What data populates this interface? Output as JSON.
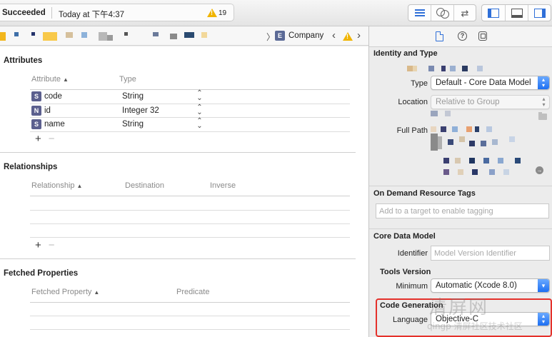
{
  "toolbar": {
    "status_text": "Succeeded",
    "status_time": "Today at 下午4:37",
    "warning_count": "19"
  },
  "jumpbar": {
    "entity_badge": "E",
    "entity_name": "Company"
  },
  "attributes": {
    "title": "Attributes",
    "col_attribute": "Attribute",
    "col_type": "Type",
    "rows": [
      {
        "badge": "S",
        "name": "code",
        "type": "String"
      },
      {
        "badge": "N",
        "name": "id",
        "type": "Integer 32"
      },
      {
        "badge": "S",
        "name": "name",
        "type": "String"
      }
    ]
  },
  "relationships": {
    "title": "Relationships",
    "col_relationship": "Relationship",
    "col_destination": "Destination",
    "col_inverse": "Inverse"
  },
  "fetched": {
    "title": "Fetched Properties",
    "col_fetched": "Fetched Property",
    "col_predicate": "Predicate"
  },
  "inspector": {
    "identity": {
      "title": "Identity and Type",
      "type_label": "Type",
      "type_value": "Default - Core Data Model",
      "location_label": "Location",
      "location_value": "Relative to Group",
      "fullpath_label": "Full Path"
    },
    "tags": {
      "title": "On Demand Resource Tags",
      "placeholder": "Add to a target to enable tagging"
    },
    "core_data": {
      "title": "Core Data Model",
      "identifier_label": "Identifier",
      "identifier_placeholder": "Model Version Identifier"
    },
    "tools": {
      "title": "Tools Version",
      "minimum_label": "Minimum",
      "minimum_value": "Automatic (Xcode 8.0)"
    },
    "codegen": {
      "title": "Code Generation",
      "language_label": "Language",
      "language_value": "Objective-C"
    }
  },
  "watermark": {
    "main": "清屏网",
    "sub": "qingp 清屏社区技术社区"
  },
  "colors": {
    "accent_blue": "#2f6fd8",
    "warning_yellow": "#f0b400",
    "highlight_red": "#e4312b",
    "badge_purple": "#5b5f8e"
  }
}
